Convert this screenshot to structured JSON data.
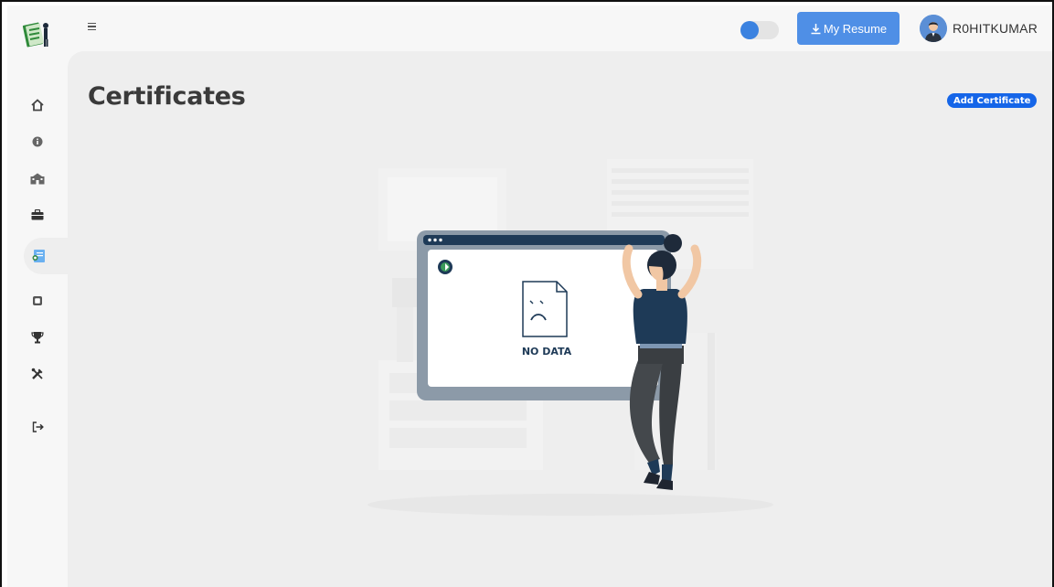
{
  "header": {
    "menu_icon": "hamburger-icon",
    "theme_toggle": {
      "state": "off",
      "color": "#3b82e0"
    },
    "resume_button": {
      "icon": "download-icon",
      "label": "My Resume"
    },
    "user": {
      "avatar_icon": "user-avatar-icon",
      "name": "R0HITKUMAR"
    }
  },
  "sidebar": {
    "logo_icon": "app-logo-icon",
    "items": [
      {
        "name": "home",
        "icon": "home-icon"
      },
      {
        "name": "about",
        "icon": "info-icon"
      },
      {
        "name": "education",
        "icon": "building-icon"
      },
      {
        "name": "experience",
        "icon": "briefcase-icon"
      },
      {
        "name": "certificates",
        "icon": "certificate-icon",
        "active": true
      },
      {
        "name": "projects",
        "icon": "chip-icon"
      },
      {
        "name": "achievements",
        "icon": "trophy-icon"
      },
      {
        "name": "skills",
        "icon": "tools-icon"
      },
      {
        "name": "logout",
        "icon": "logout-icon"
      }
    ]
  },
  "main": {
    "title": "Certificates",
    "add_button": "Add Certificate",
    "empty_state": {
      "text": "NO DATA"
    }
  },
  "colors": {
    "accent": "#1565e8",
    "resume_button": "#4f8fe6",
    "background": "#eeeeee"
  }
}
